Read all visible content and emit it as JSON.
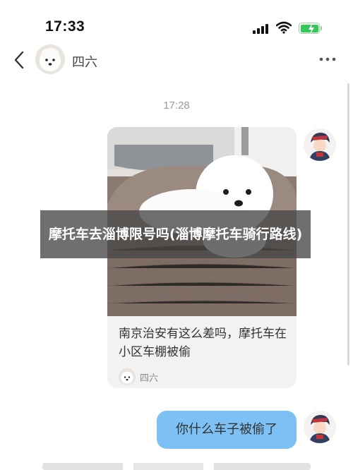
{
  "status_bar": {
    "time": "17:33",
    "battery_charging": true,
    "battery_color": "#35c759"
  },
  "nav": {
    "title": "四六",
    "back_icon": "chevron-left-icon",
    "more_icon": "ellipsis-icon"
  },
  "chat": {
    "timestamp": "17:28",
    "shared_post": {
      "caption": "南京治安有这么差吗，摩托车在小区车棚被偷",
      "author": "四六"
    },
    "reply": {
      "text": "你什么车子被偷了",
      "bubble_color": "#7dc1f4"
    }
  },
  "overlay": {
    "title": "摩托车去淄博限号吗(淄博摩托车骑行路线)"
  }
}
